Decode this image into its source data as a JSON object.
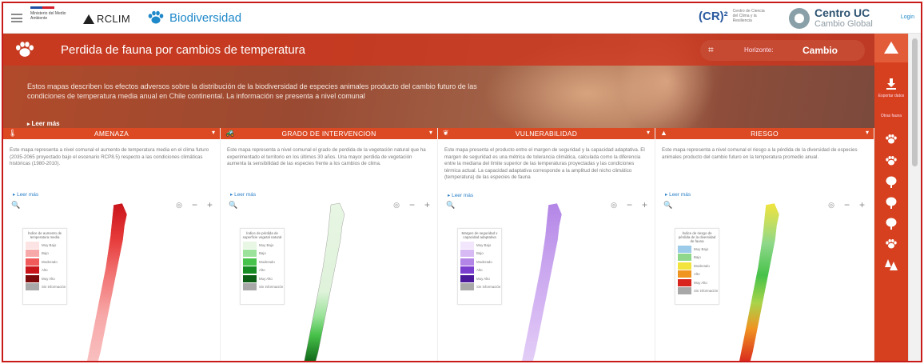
{
  "header": {
    "ministry_text": "Ministerio del Medio Ambiente",
    "arclim_label": "RCLIM",
    "app_name": "Biodiversidad",
    "cr2_label": "(CR)²",
    "cr2_sub": "Centro de Ciencia del Clima y la Resiliencia",
    "centro_name": "Centro UC",
    "centro_sub": "Cambio Global",
    "login_label": "Login"
  },
  "hero": {
    "title": "Perdida de fauna por cambios de temperatura",
    "horizon_label": "Horizonte:",
    "horizon_value": "Cambio",
    "description": "Estos mapas describen los efectos adversos sobre la distribución de la biodiversidad de especies animales producto del cambio futuro de las condiciones de temperatura media anual en Chile continental. La información se presenta a nivel comunal",
    "read_more": "Leer más"
  },
  "sidebar": {
    "items": [
      {
        "label": "Exportar datos",
        "icon": "download-icon"
      },
      {
        "label": "Otras fauna",
        "icon": "menu-icon"
      },
      {
        "label": "",
        "icon": "paw-icon"
      },
      {
        "label": "",
        "icon": "paw-icon"
      },
      {
        "label": "",
        "icon": "tree-icon"
      },
      {
        "label": "",
        "icon": "tree-icon"
      },
      {
        "label": "",
        "icon": "tree-icon"
      },
      {
        "label": "",
        "icon": "paw-icon"
      },
      {
        "label": "",
        "icon": "mountain-tree-icon"
      }
    ]
  },
  "panels": [
    {
      "title": "AMENAZA",
      "icon": "thermometer-icon",
      "description": "Este mapa representa a nivel comunal el aumento de temperatura media en el clima futuro (2035-2065 proyectado bajo el escenario RCP8.5) respecto a las condiciones climáticas históricas (1980-2010).",
      "read_more": "Leer más",
      "legend_title": "Índice de aumento de temperatura media",
      "legend": [
        {
          "label": "Muy Bajo",
          "color": "#fde4e4"
        },
        {
          "label": "Bajo",
          "color": "#f7a8a8"
        },
        {
          "label": "Moderado",
          "color": "#f05a5a"
        },
        {
          "label": "Alto",
          "color": "#c9141a"
        },
        {
          "label": "Muy Alto",
          "color": "#7d0a0a"
        },
        {
          "label": "Sin información",
          "color": "#a8a8a8"
        }
      ]
    },
    {
      "title": "GRADO DE INTERVENCION",
      "icon": "tractor-icon",
      "description": "Este mapa representa a nivel comunal el grado de perdida de la vegetación natural que ha experimentado el territorio en los últimos 30 años. Una mayor perdida de vegetación aumenta la sensibilidad de las especies frente a los cambios de clima.",
      "read_more": "Leer más",
      "legend_title": "Índice de pérdida de superficie vegetal natural",
      "legend": [
        {
          "label": "Muy Bajo",
          "color": "#e8f6e4"
        },
        {
          "label": "Bajo",
          "color": "#9be39a"
        },
        {
          "label": "Moderado",
          "color": "#47c24a"
        },
        {
          "label": "Alto",
          "color": "#168c22"
        },
        {
          "label": "Muy Alto",
          "color": "#0b5e14"
        },
        {
          "label": "Sin información",
          "color": "#a8a8a8"
        }
      ]
    },
    {
      "title": "VULNERABILIDAD",
      "icon": "leaf-icon",
      "description": "Este mapa presenta el producto entre el margen de seguridad y la capacidad adaptativa. El margen de seguridad es una métrica de tolerancia climática, calculada como la diferencia entre la mediana del límite superior de las temperaturas proyectadas y las condiciones térmica actual. La capacidad adaptativa corresponde a la amplitud del nicho climático (temperatura) de las especies de fauna",
      "read_more": "Leer más",
      "legend_title": "Margen de seguridad x capacidad adaptativa",
      "legend": [
        {
          "label": "Muy Bajo",
          "color": "#f1e6fb"
        },
        {
          "label": "Bajo",
          "color": "#d7b9f3"
        },
        {
          "label": "Moderado",
          "color": "#b385e6"
        },
        {
          "label": "Alto",
          "color": "#7b3fcf"
        },
        {
          "label": "Muy Alto",
          "color": "#4a1a9a"
        },
        {
          "label": "Sin información",
          "color": "#a8a8a8"
        }
      ]
    },
    {
      "title": "RIESGO",
      "icon": "warning-icon",
      "description": "Este mapa representa a nivel comunal el riesgo a la pérdida de la diversidad de especies animales producto del cambio futuro en la temperatura promedio anual.",
      "read_more": "Leer más",
      "legend_title": "Índice de riesgo de pérdida de la diversidad de fauna",
      "legend": [
        {
          "label": "Muy Bajo",
          "color": "#9bcbe8"
        },
        {
          "label": "Bajo",
          "color": "#8fd88a"
        },
        {
          "label": "Moderado",
          "color": "#f2e43c"
        },
        {
          "label": "Alto",
          "color": "#f09422"
        },
        {
          "label": "Muy Alto",
          "color": "#d8241c"
        },
        {
          "label": "Sin información",
          "color": "#a8a8a8"
        }
      ]
    }
  ]
}
